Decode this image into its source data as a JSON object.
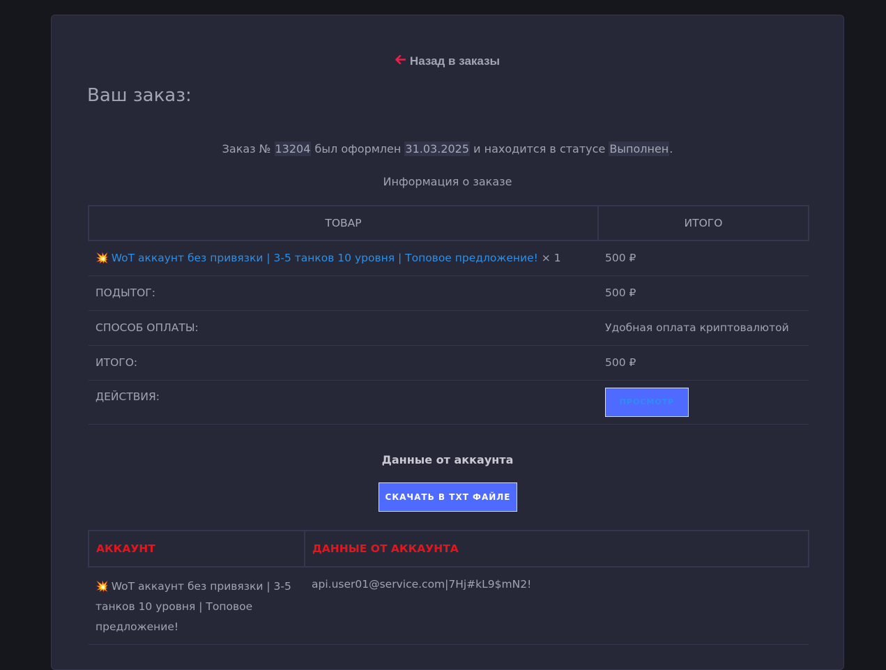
{
  "back_link": {
    "arrow": "🡐",
    "label": "Назад в заказы",
    "icon": "arrow-left-icon"
  },
  "page_title": "Ваш заказ:",
  "order_summary": {
    "prefix": "Заказ №",
    "order_number": "13204",
    "placed_text": "был оформлен",
    "date": "31.03.2025",
    "status_text": "и находится в статусе",
    "status": "Выполнен",
    "suffix": "."
  },
  "info_heading": "Информация о заказе",
  "order_table": {
    "headers": {
      "product": "Товар",
      "total": "Итого"
    },
    "item": {
      "icon": "💥",
      "name": "WoT аккаунт без привязки | 3-5 танков 10 уровня | Топовое предложение!",
      "quantity": "× 1",
      "price": "500 ₽"
    },
    "rows": [
      {
        "label": "ПОДЫТОГ:",
        "value": "500 ₽"
      },
      {
        "label": "СПОСОБ ОПЛАТЫ:",
        "value": "Удобная оплата криптовалютой"
      },
      {
        "label": "ИТОГО:",
        "value": "500 ₽"
      }
    ],
    "actions_label": "ДЕЙСТВИЯ:",
    "view_button": "Просмотр"
  },
  "account_heading": "Данные от аккаунта",
  "download_button": "Скачать в TXT файле",
  "account_table": {
    "headers": {
      "account": "Аккаунт",
      "data": "Данные от аккаунта"
    },
    "row": {
      "icon": "💥",
      "account": "WoT аккаунт без привязки | 3-5 танков 10 уровня | Топовое предложение!",
      "data": "api.user01@service.com|7Hj#kL9$mN2!"
    }
  },
  "colors": {
    "background": "#16171c",
    "card": "#262837",
    "accent_red": "#e5224a",
    "link_blue": "#2d8fe5",
    "button_blue": "#4f6bff",
    "header_red": "#e3161e"
  }
}
